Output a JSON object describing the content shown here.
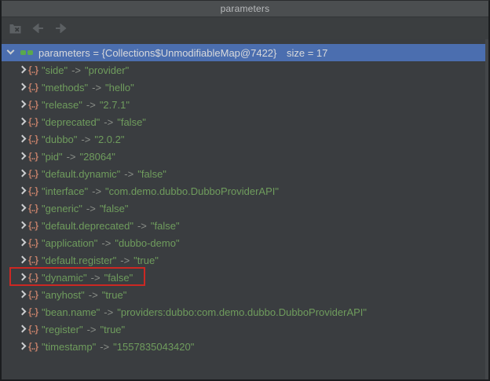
{
  "window": {
    "title": "parameters"
  },
  "toolbar": {
    "buttons": [
      {
        "label": "close-folder",
        "icon": "folder-x-icon",
        "enabled": false
      },
      {
        "label": "back",
        "icon": "back-arrow-icon",
        "enabled": false
      },
      {
        "label": "forward",
        "icon": "forward-arrow-icon",
        "enabled": false
      }
    ]
  },
  "tree": {
    "root": {
      "name": "parameters",
      "equals": "=",
      "type_ref": "{Collections$UnmodifiableMap@7422}",
      "size_label": "size = 17",
      "selected": true
    },
    "arrow": "->",
    "entries": [
      {
        "key": "\"side\"",
        "value": "\"provider\""
      },
      {
        "key": "\"methods\"",
        "value": "\"hello\""
      },
      {
        "key": "\"release\"",
        "value": "\"2.7.1\""
      },
      {
        "key": "\"deprecated\"",
        "value": "\"false\""
      },
      {
        "key": "\"dubbo\"",
        "value": "\"2.0.2\""
      },
      {
        "key": "\"pid\"",
        "value": "\"28064\""
      },
      {
        "key": "\"default.dynamic\"",
        "value": "\"false\""
      },
      {
        "key": "\"interface\"",
        "value": "\"com.demo.dubbo.DubboProviderAPI\""
      },
      {
        "key": "\"generic\"",
        "value": "\"false\""
      },
      {
        "key": "\"default.deprecated\"",
        "value": "\"false\""
      },
      {
        "key": "\"application\"",
        "value": "\"dubbo-demo\""
      },
      {
        "key": "\"default.register\"",
        "value": "\"true\""
      },
      {
        "key": "\"dynamic\"",
        "value": "\"false\"",
        "highlighted": true
      },
      {
        "key": "\"anyhost\"",
        "value": "\"true\""
      },
      {
        "key": "\"bean.name\"",
        "value": "\"providers:dubbo:com.demo.dubbo.DubboProviderAPI\""
      },
      {
        "key": "\"register\"",
        "value": "\"true\""
      },
      {
        "key": "\"timestamp\"",
        "value": "\"1557835043420\""
      }
    ]
  },
  "colors": {
    "titlebar_bg": "#4b4e50",
    "panel_bg": "#3a3d40",
    "selection_blue": "#4b6eaf",
    "string_green": "#6f9c5d",
    "entry_icon_salmon": "#bd7d68",
    "glasses_green": "#5aa84d",
    "highlight_red": "#cc2823"
  }
}
